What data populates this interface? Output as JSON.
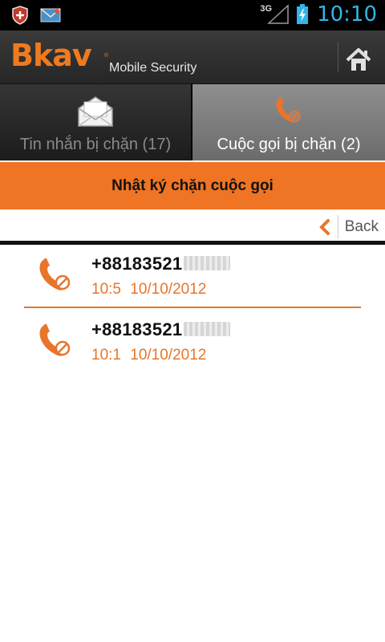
{
  "status_bar": {
    "network": "3G",
    "clock": "10:10",
    "icons": [
      "shield-notification-icon",
      "mail-notification-icon",
      "signal-icon",
      "battery-charging-icon"
    ]
  },
  "header": {
    "logo": "Bkav",
    "logo_mark": "®",
    "product": "Mobile Security",
    "home_icon": "home-icon",
    "accent": "#f07a1e"
  },
  "tabs": [
    {
      "label": "Tin nhắn bị chặn (17)",
      "icon": "envelope-icon",
      "selected": false
    },
    {
      "label": "Cuộc gọi bị chặn (2)",
      "icon": "blocked-call-icon",
      "selected": true
    }
  ],
  "section": {
    "title": "Nhật ký chặn cuộc gọi",
    "background": "#ef7423"
  },
  "back": {
    "label": "Back",
    "icon": "chevron-left-icon"
  },
  "calls": [
    {
      "number": "+88183521",
      "time": "10:5 10/10/2012",
      "icon": "blocked-call-icon"
    },
    {
      "number": "+88183521",
      "time": "10:1 10/10/2012",
      "icon": "blocked-call-icon"
    }
  ]
}
